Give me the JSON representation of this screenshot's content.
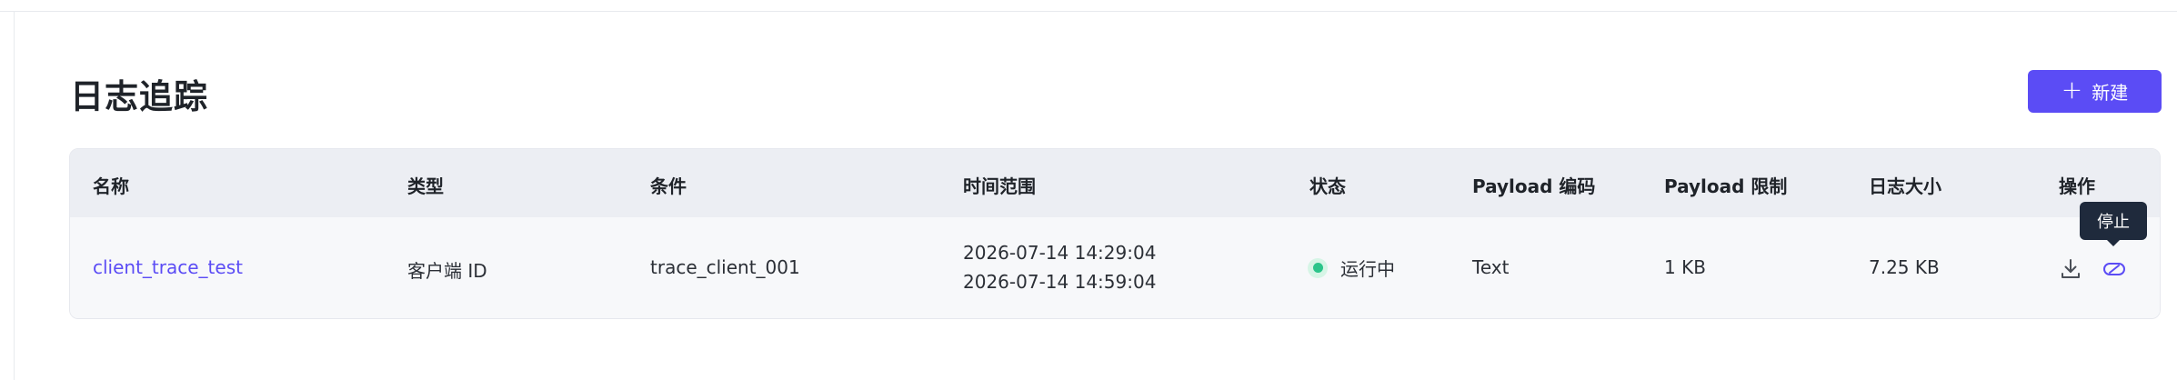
{
  "page": {
    "title": "日志追踪",
    "new_button_label": "新建",
    "new_button_icon": "plus-icon"
  },
  "table": {
    "columns": [
      "名称",
      "类型",
      "条件",
      "时间范围",
      "状态",
      "Payload 编码",
      "Payload 限制",
      "日志大小",
      "操作"
    ],
    "rows": [
      {
        "name": "client_trace_test",
        "type": "客户端 ID",
        "condition": "trace_client_001",
        "time_start": "2026-07-14 14:29:04",
        "time_end": "2026-07-14 14:59:04",
        "status": "运行中",
        "status_color": "#2bc48a",
        "payload_encoding": "Text",
        "payload_limit": "1 KB",
        "log_size": "7.25 KB",
        "actions": [
          "download-icon",
          "stop-icon"
        ]
      }
    ]
  },
  "tooltip": {
    "text": "停止"
  },
  "colors": {
    "accent": "#5b4cf5",
    "header_bg": "#eceef3",
    "tooltip_bg": "#1f2a3c"
  }
}
